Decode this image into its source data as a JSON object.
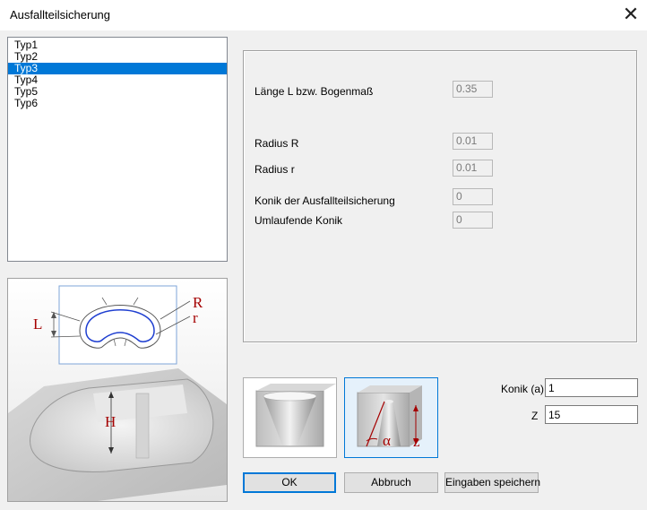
{
  "window": {
    "title": "Ausfallteilsicherung",
    "close_glyph": "✕",
    "close_icon": "close-icon"
  },
  "type_list": {
    "items": [
      "Typ1",
      "Typ2",
      "Typ3",
      "Typ4",
      "Typ5",
      "Typ6"
    ],
    "selected_index": 2
  },
  "parameters": {
    "laenge": {
      "label": "Länge L bzw. Bogenmaß",
      "value": "0.35"
    },
    "radius_R": {
      "label": "Radius R",
      "value": "0.01"
    },
    "radius_r": {
      "label": "Radius r",
      "value": "0.01"
    },
    "konik_ausfall": {
      "label": "Konik der Ausfallteilsicherung",
      "value": "0"
    },
    "umlaufende": {
      "label": "Umlaufende Konik",
      "value": "0"
    }
  },
  "preview": {
    "letters": {
      "L": "L",
      "R": "R",
      "r": "r",
      "H": "H"
    }
  },
  "cone_buttons": {
    "alpha": "α",
    "z": "z"
  },
  "konik_input": {
    "label": "Konik (a)",
    "value": "1"
  },
  "z_input": {
    "label": "Z",
    "value": "15"
  },
  "buttons": {
    "ok": "OK",
    "cancel": "Abbruch",
    "save": "Eingaben speichern"
  },
  "colors": {
    "selection": "#0078d7",
    "annotation": "#a40000",
    "profile_blue": "#1f3fd0"
  }
}
